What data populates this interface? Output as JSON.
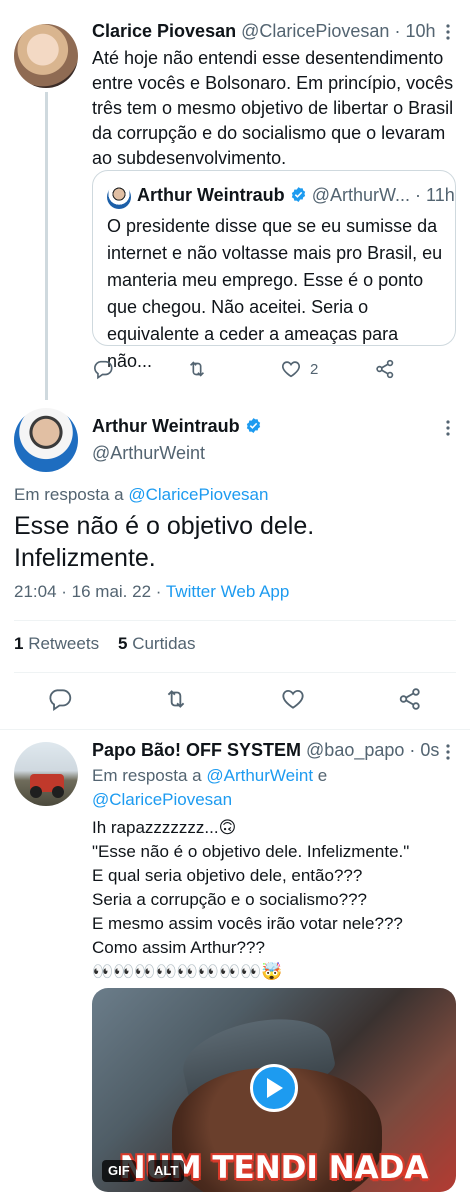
{
  "colors": {
    "accent": "#1d9bf0",
    "muted": "#536471",
    "text": "#0f1419",
    "border": "#cfd9de"
  },
  "tweet1": {
    "name": "Clarice Piovesan",
    "handle": "@ClaricePiovesan",
    "sep": "·",
    "time": "10h",
    "text": "Até hoje não entendi esse desentendimento entre vocês e Bolsonaro. Em princípio, vocês três tem o mesmo objetivo de libertar o Brasil da corrupção e do socialismo que o levaram ao subdesenvolvimento.",
    "quote": {
      "name": "Arthur Weintraub",
      "handle": "@ArthurW...",
      "sep": "·",
      "time": "11h",
      "text": "O presidente disse que se eu sumisse da internet e não voltasse mais pro Brasil, eu manteria meu emprego. Esse é o ponto que chegou. Não aceitei. Seria o equivalente a ceder a ameaças para não..."
    },
    "actions": {
      "like_count": "2"
    }
  },
  "main": {
    "name": "Arthur Weintraub",
    "handle": "@ArthurWeint",
    "reply_prefix": "Em resposta a",
    "reply_to": "@ClaricePiovesan",
    "text": "Esse não é o objetivo dele. Infelizmente.",
    "time": "21:04 · 16 mai. 22",
    "meta_sep": "·",
    "source": "Twitter Web App",
    "retweets_count": "1",
    "retweets_label": "Retweets",
    "likes_count": "5",
    "likes_label": "Curtidas"
  },
  "reply": {
    "name": "Papo Bão! OFF SYSTEM",
    "handle": "@bao_papo",
    "sep": "·",
    "time": "0s",
    "reply_prefix": "Em resposta a",
    "reply_to_1": "@ArthurWeint",
    "reply_and": "e",
    "reply_to_2": "@ClaricePiovesan",
    "text": "Ih rapazzzzzzz...🙃\n\"Esse não é o objetivo dele. Infelizmente.\"\nE qual seria objetivo dele, então???\nSeria a corrupção e o socialismo???\nE mesmo assim vocês irão votar nele???\nComo assim Arthur???\n👀👀👀👀👀👀👀👀🤯",
    "media": {
      "caption": "NUM TENDI NADA",
      "gif_badge": "GIF",
      "alt_badge": "ALT"
    }
  },
  "icons": {
    "reply": "reply-icon",
    "retweet": "retweet-icon",
    "like": "like-icon",
    "share": "share-icon",
    "verified": "verified-badge-icon",
    "more": "more-options-icon",
    "play": "play-icon"
  }
}
